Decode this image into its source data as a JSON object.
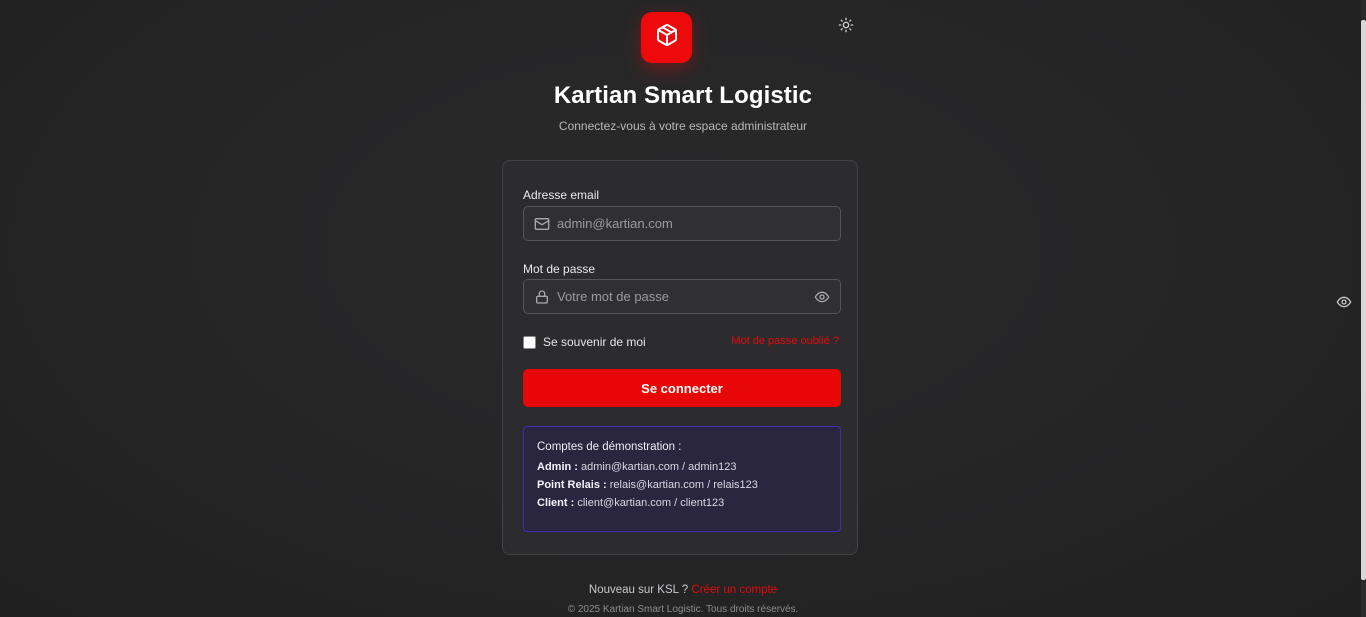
{
  "app": {
    "title": "Kartian Smart Logistic",
    "subtitle": "Connectez-vous à votre espace administrateur",
    "logo_icon": "package-icon",
    "accent_color": "#e70707"
  },
  "form": {
    "email_label": "Adresse email",
    "email_placeholder": "admin@kartian.com",
    "email_value": "",
    "password_label": "Mot de passe",
    "password_placeholder": "Votre mot de passe",
    "password_value": "",
    "remember_label": "Se souvenir de moi",
    "remember_checked": false,
    "forgot_label": "Mot de passe oublié ?",
    "submit_label": "Se connecter"
  },
  "demo": {
    "title": "Comptes de démonstration :",
    "accounts": [
      {
        "role": "Admin :",
        "credentials": "admin@kartian.com / admin123"
      },
      {
        "role": "Point Relais :",
        "credentials": "relais@kartian.com / relais123"
      },
      {
        "role": "Client :",
        "credentials": "client@kartian.com / client123"
      }
    ]
  },
  "footer": {
    "signup_prompt": "Nouveau sur KSL ?",
    "signup_link": "Créer un compte",
    "copyright": "© 2025 Kartian Smart Logistic. Tous droits réservés."
  },
  "icons": {
    "theme_toggle": "sun-icon",
    "email": "mail-icon",
    "password": "lock-icon",
    "show_password": "eye-icon"
  }
}
